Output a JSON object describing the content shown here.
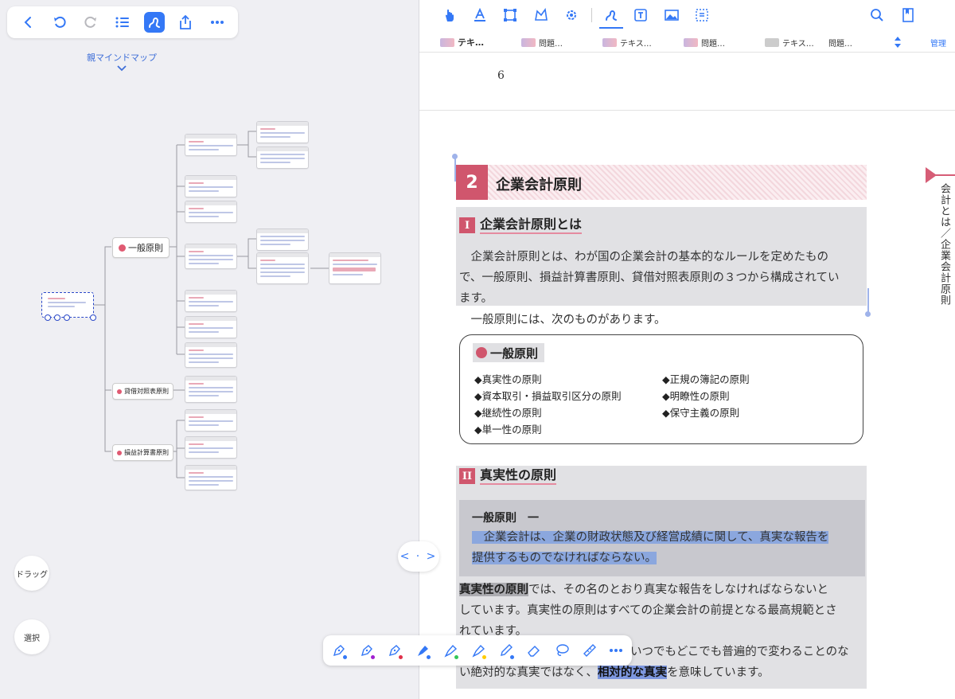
{
  "left_toolbar": {
    "icons": [
      "back-icon",
      "undo-icon",
      "redo-icon",
      "list-icon",
      "pen-mode-icon",
      "share-icon",
      "more-icon"
    ]
  },
  "parent_map_label": "親マインドマップ",
  "mindmap": {
    "branches": [
      {
        "label": "一般原則"
      },
      {
        "label": "貸借対照表原則"
      },
      {
        "label": "損益計算書原則"
      }
    ]
  },
  "drag_button_label": "ドラッグ",
  "select_button_label": "選択",
  "right_toolbar": {
    "icons": [
      "hand-icon",
      "text-underline-icon",
      "crop-icon",
      "shape-icon",
      "settings-icon",
      "pen-icon",
      "textbox-icon",
      "image-icon",
      "dotted-select-icon",
      "search-icon",
      "bookmark-icon"
    ]
  },
  "tabs": [
    {
      "label": "テキ…",
      "active": true
    },
    {
      "label": "問題…",
      "active": false
    },
    {
      "label": "テキス…",
      "active": false
    },
    {
      "label": "問題…",
      "active": false
    },
    {
      "label": "テキス…",
      "active": false
    },
    {
      "label": "問題…",
      "active": false
    }
  ],
  "manage_label": "管理",
  "page": {
    "number": "6",
    "section_number": "2",
    "section_title": "企業会計原則",
    "sub1": {
      "numeral": "I",
      "title": "企業会計原則とは"
    },
    "para1_lines": [
      "　企業会計原則とは、わが国の企業会計の基本的なルールを定めたもの",
      "で、一般原則、損益計算書原則、貸借対照表原則の３つから構成されてい",
      "ます。"
    ],
    "para2": "　一般原則には、次のものがあります。",
    "box_title": "一般原則",
    "box_items_left": [
      "◆真実性の原則",
      "◆資本取引・損益取引区分の原則",
      "◆継続性の原則",
      "◆単一性の原則"
    ],
    "box_items_right": [
      "◆正規の簿記の原則",
      "◆明瞭性の原則",
      "◆保守主義の原則"
    ],
    "sub2": {
      "numeral": "II",
      "title": "真実性の原則"
    },
    "quote_head": "一般原則　一",
    "quote_line1": "　企業会計は、企業の財政状態及び経営成績に関して、真実な報告を",
    "quote_line2": "提供するものでなければならない。",
    "para3_strong": "真実性の原則",
    "para3_line1_rest": "では、その名のとおり真実な報告をしなければならないと",
    "para3_line2": "しています。真実性の原則はすべての企業会計の前提となる最高規範とさ",
    "para3_line3": "れています。",
    "para4_line1_tail": "いつでもどこでも普遍的で変わることのな",
    "para4_line2_pre": "い絶対的な真実ではなく、",
    "para4_line2_strong": "相対的な真実",
    "para4_line2_post": "を意味しています。",
    "side_tab_text": "会計とは／企業会計原則"
  },
  "pen_toolbar": {
    "tools": [
      {
        "icon": "fountain-pen-icon",
        "color": "#3478f6"
      },
      {
        "icon": "fountain-pen-icon",
        "color": "#a020d0"
      },
      {
        "icon": "fountain-pen-icon",
        "color": "#e0304a"
      },
      {
        "icon": "highlighter-icon",
        "color": "#3478f6"
      },
      {
        "icon": "highlighter-icon",
        "color": "#34c759"
      },
      {
        "icon": "highlighter-icon",
        "color": "#ffcc00"
      },
      {
        "icon": "pencil-icon",
        "color": "#3478f6"
      },
      {
        "icon": "eraser-icon",
        "color": ""
      },
      {
        "icon": "lasso-icon",
        "color": ""
      },
      {
        "icon": "ruler-icon",
        "color": ""
      },
      {
        "icon": "more-icon",
        "color": ""
      }
    ]
  },
  "colors": {
    "accent": "#3478f6",
    "brand_pink": "#d0566d"
  }
}
